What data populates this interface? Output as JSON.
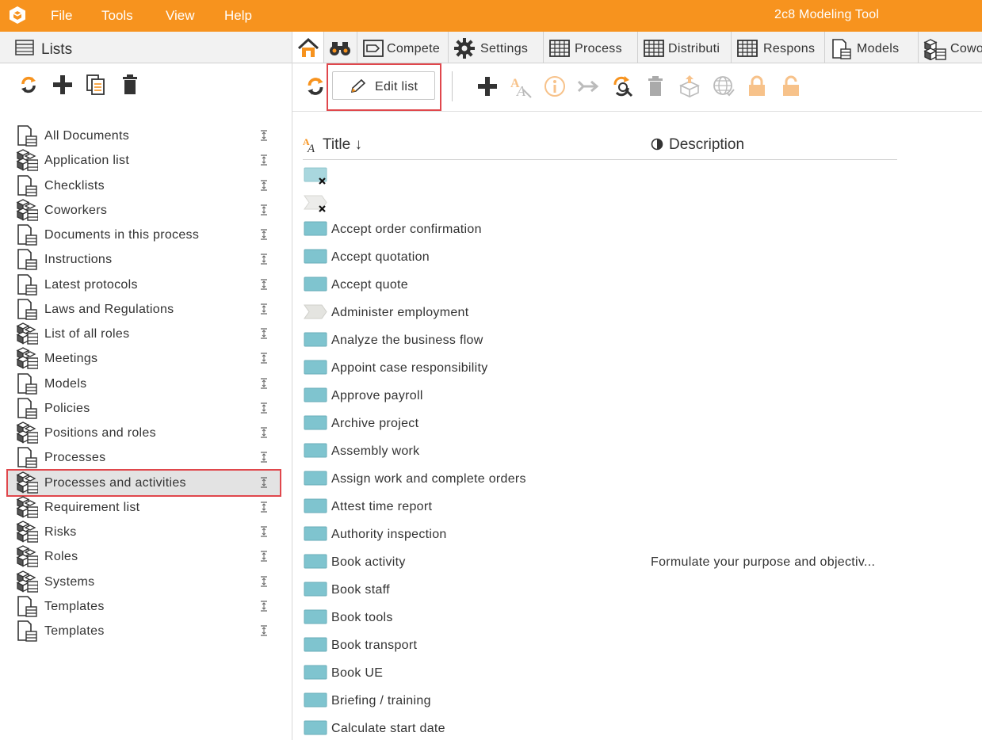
{
  "app": {
    "title": "2c8 Modeling Tool",
    "menu": [
      "File",
      "Tools",
      "View",
      "Help"
    ],
    "accent_color": "#f7931e",
    "highlight_color": "#e0474c"
  },
  "left_panel": {
    "title": "Lists",
    "toolbar": [
      "refresh-icon",
      "add-icon",
      "copy-icon",
      "delete-icon"
    ],
    "items": [
      {
        "label": "All Documents",
        "icon": "document-icon"
      },
      {
        "label": "Application list",
        "icon": "cubes-icon"
      },
      {
        "label": "Checklists",
        "icon": "document-icon"
      },
      {
        "label": "Coworkers",
        "icon": "cubes-icon"
      },
      {
        "label": "Documents in this process",
        "icon": "document-icon"
      },
      {
        "label": "Instructions",
        "icon": "document-icon"
      },
      {
        "label": "Latest protocols",
        "icon": "document-icon"
      },
      {
        "label": "Laws and Regulations",
        "icon": "document-icon"
      },
      {
        "label": "List of all roles",
        "icon": "cubes-icon"
      },
      {
        "label": "Meetings",
        "icon": "cubes-icon"
      },
      {
        "label": "Models",
        "icon": "document-icon"
      },
      {
        "label": "Policies",
        "icon": "document-icon"
      },
      {
        "label": "Positions and roles",
        "icon": "cubes-icon"
      },
      {
        "label": "Processes",
        "icon": "document-icon"
      },
      {
        "label": "Processes and activities",
        "icon": "cubes-icon",
        "selected": true
      },
      {
        "label": "Requirement list",
        "icon": "cubes-icon"
      },
      {
        "label": "Risks",
        "icon": "cubes-icon"
      },
      {
        "label": "Roles",
        "icon": "cubes-icon"
      },
      {
        "label": "Systems",
        "icon": "cubes-icon"
      },
      {
        "label": "Templates",
        "icon": "document-icon"
      },
      {
        "label": "Templates",
        "icon": "document-icon"
      }
    ]
  },
  "tabs": [
    {
      "label": "",
      "icon": "home-icon",
      "active": true
    },
    {
      "label": "",
      "icon": "binoculars-icon"
    },
    {
      "label": "Compete",
      "icon": "tag-icon"
    },
    {
      "label": "Settings",
      "icon": "gear-icon"
    },
    {
      "label": "Process",
      "icon": "table-icon"
    },
    {
      "label": "Distributi",
      "icon": "table-icon"
    },
    {
      "label": "Respons",
      "icon": "table-icon"
    },
    {
      "label": "Models",
      "icon": "document-icon"
    },
    {
      "label": "Cowo",
      "icon": "cubes-icon"
    }
  ],
  "toolbar": {
    "edit_list_label": "Edit list",
    "tools": [
      "add-icon",
      "rename-icon",
      "info-icon",
      "move-icon",
      "replace-icon",
      "delete-icon",
      "export-icon",
      "globe-icon",
      "lock-icon",
      "unlock-icon"
    ]
  },
  "table": {
    "columns": {
      "title": "Title ↓",
      "description": "Description"
    },
    "rows": [
      {
        "title": "",
        "description": "",
        "icon": "activity-missing-icon"
      },
      {
        "title": "",
        "description": "",
        "icon": "process-missing-icon"
      },
      {
        "title": "Accept order confirmation",
        "description": "",
        "icon": "activity-icon"
      },
      {
        "title": "Accept quotation",
        "description": "",
        "icon": "activity-icon"
      },
      {
        "title": "Accept quote",
        "description": "",
        "icon": "activity-icon"
      },
      {
        "title": "Administer employment",
        "description": "",
        "icon": "process-icon"
      },
      {
        "title": "Analyze the business flow",
        "description": "",
        "icon": "activity-icon"
      },
      {
        "title": "Appoint case responsibility",
        "description": "",
        "icon": "activity-icon"
      },
      {
        "title": "Approve payroll",
        "description": "",
        "icon": "activity-icon"
      },
      {
        "title": "Archive project",
        "description": "",
        "icon": "activity-icon"
      },
      {
        "title": "Assembly work",
        "description": "",
        "icon": "activity-icon"
      },
      {
        "title": "Assign work and complete orders",
        "description": "",
        "icon": "activity-icon"
      },
      {
        "title": "Attest time report",
        "description": "",
        "icon": "activity-icon"
      },
      {
        "title": "Authority inspection",
        "description": "",
        "icon": "activity-icon"
      },
      {
        "title": "Book activity",
        "description": "Formulate your purpose and objectiv...",
        "icon": "activity-icon"
      },
      {
        "title": "Book staff",
        "description": "",
        "icon": "activity-icon"
      },
      {
        "title": "Book tools",
        "description": "",
        "icon": "activity-icon"
      },
      {
        "title": "Book transport",
        "description": "",
        "icon": "activity-icon"
      },
      {
        "title": "Book UE",
        "description": "",
        "icon": "activity-icon"
      },
      {
        "title": "Briefing / training",
        "description": "",
        "icon": "activity-icon"
      },
      {
        "title": "Calculate start date",
        "description": "",
        "icon": "activity-icon"
      }
    ]
  }
}
